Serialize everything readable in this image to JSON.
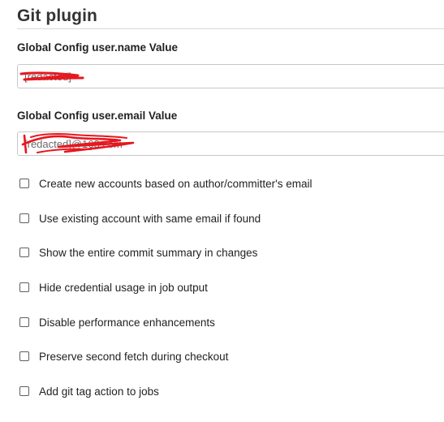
{
  "section": {
    "title": "Git plugin"
  },
  "fields": {
    "user_name": {
      "label": "Global Config user.name Value",
      "value": "[redacted]"
    },
    "user_email": {
      "label": "Global Config user.email Value",
      "value": "[redacted]@163.com"
    }
  },
  "checkboxes": [
    {
      "label": "Create new accounts based on author/committer's email",
      "checked": false
    },
    {
      "label": "Use existing account with same email if found",
      "checked": false
    },
    {
      "label": "Show the entire commit summary in changes",
      "checked": false
    },
    {
      "label": "Hide credential usage in job output",
      "checked": false
    },
    {
      "label": "Disable performance enhancements",
      "checked": false
    },
    {
      "label": "Preserve second fetch during checkout",
      "checked": false
    },
    {
      "label": "Add git tag action to jobs",
      "checked": false
    }
  ],
  "colors": {
    "redaction": "#e8161e",
    "border": "#c8c8c8"
  }
}
